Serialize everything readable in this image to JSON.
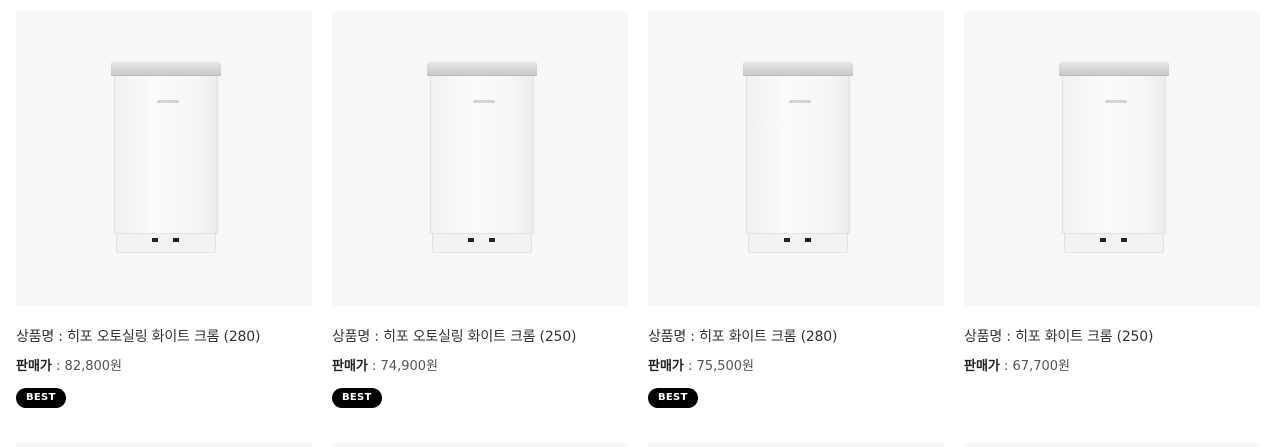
{
  "products": [
    {
      "name_label": "상품명",
      "name_sep": " : ",
      "name": "히포 오토실링 화이트 크롬 (280)",
      "price_label": "판매가",
      "price_sep": " : ",
      "price": "82,800원",
      "badge": "BEST",
      "image_icon": "waste-bin-product-image"
    },
    {
      "name_label": "상품명",
      "name_sep": " : ",
      "name": "히포 오토실링 화이트 크롬 (250)",
      "price_label": "판매가",
      "price_sep": " : ",
      "price": "74,900원",
      "badge": "BEST",
      "image_icon": "waste-bin-product-image"
    },
    {
      "name_label": "상품명",
      "name_sep": " : ",
      "name": "히포 화이트 크롬 (280)",
      "price_label": "판매가",
      "price_sep": " : ",
      "price": "75,500원",
      "badge": "BEST",
      "image_icon": "waste-bin-product-image"
    },
    {
      "name_label": "상품명",
      "name_sep": " : ",
      "name": "히포 화이트 크롬 (250)",
      "price_label": "판매가",
      "price_sep": " : ",
      "price": "67,700원",
      "badge": "",
      "image_icon": "waste-bin-product-image"
    }
  ],
  "colors": {
    "thumb_background": "#f7f7f7",
    "badge_background": "#000000",
    "badge_text": "#ffffff"
  }
}
